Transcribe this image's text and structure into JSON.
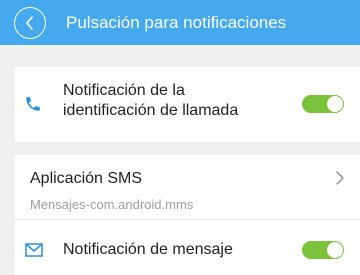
{
  "header": {
    "title": "Pulsación para notificaciones",
    "back_icon": "chevron-left-circle-icon"
  },
  "items": [
    {
      "icon": "phone-icon",
      "label_line1": "Notificación de la",
      "label_line2": "identificación de llamada",
      "toggle_on": true
    },
    {
      "label": "Aplicación SMS",
      "sublabel": "Mensajes-com.android.mms",
      "trailing_icon": "chevron-right-icon"
    },
    {
      "icon": "mail-icon",
      "label": "Notificación de mensaje",
      "toggle_on": true
    }
  ],
  "colors": {
    "header_bg": "#45a9ee",
    "accent_icon": "#2a8fdc",
    "toggle_on": "#7cc33c",
    "page_bg": "#eeeff1"
  }
}
